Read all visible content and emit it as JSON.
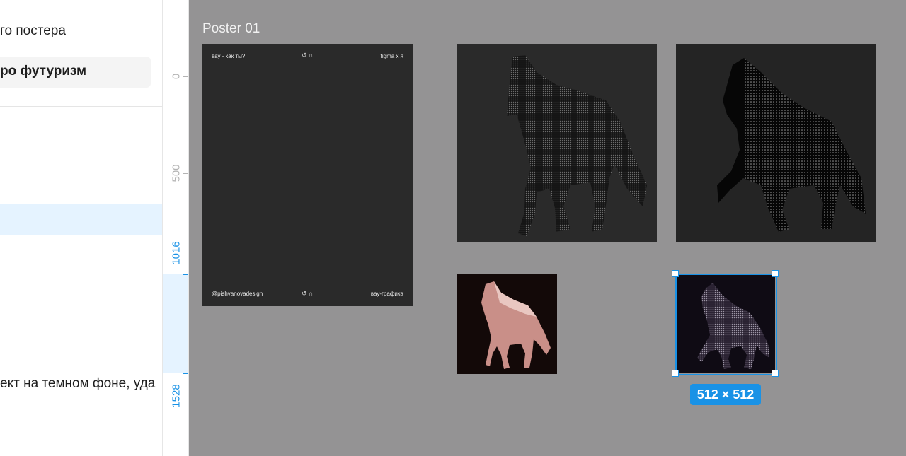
{
  "left_panel": {
    "line1": "го постера",
    "line2": "ро футуризм",
    "line3": "ект на темном фоне, уда"
  },
  "ruler": {
    "labels": [
      "0",
      "500",
      "1016",
      "1528"
    ]
  },
  "canvas": {
    "frame_label": "Poster 01",
    "poster": {
      "top_left": "вау - как ты?",
      "top_center_icon": "↺ ∩",
      "top_right": "figma x я",
      "bottom_left": "@pishvanovadesign",
      "bottom_center_icon": "↺ ∩",
      "bottom_right": "вау-графика"
    },
    "selection_size": "512 × 512"
  },
  "colors": {
    "canvas_bg": "#949394",
    "selection_blue": "#1992e6",
    "ruler_highlight": "#e5f3ff"
  }
}
